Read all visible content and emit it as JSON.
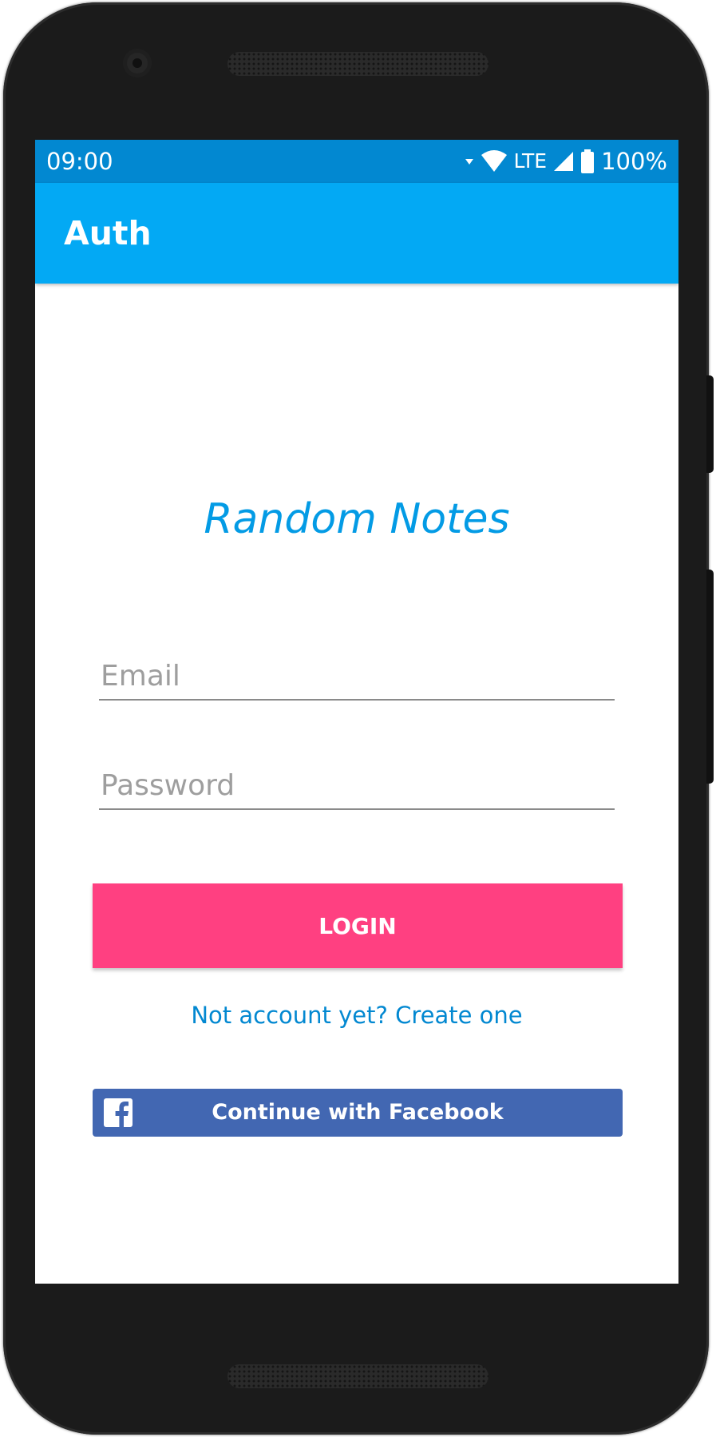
{
  "status_bar": {
    "time": "09:00",
    "network": "LTE",
    "battery": "100%"
  },
  "app_bar": {
    "title": "Auth"
  },
  "login_form": {
    "app_name": "Random Notes",
    "email_placeholder": "Email",
    "password_placeholder": "Password",
    "login_label": "LOGIN",
    "create_account_link": "Not account yet? Create one",
    "facebook_label": "Continue with Facebook"
  },
  "colors": {
    "status_bar": "#0288d1",
    "app_bar": "#03a9f4",
    "brand_text": "#039be5",
    "login_button": "#ff4081",
    "link": "#0288d1",
    "facebook_button": "#4267b2"
  },
  "icons": {
    "signal": "signal-icon",
    "wifi": "wifi-icon",
    "cellular": "cellular-icon",
    "battery": "battery-icon",
    "facebook": "facebook-icon"
  }
}
